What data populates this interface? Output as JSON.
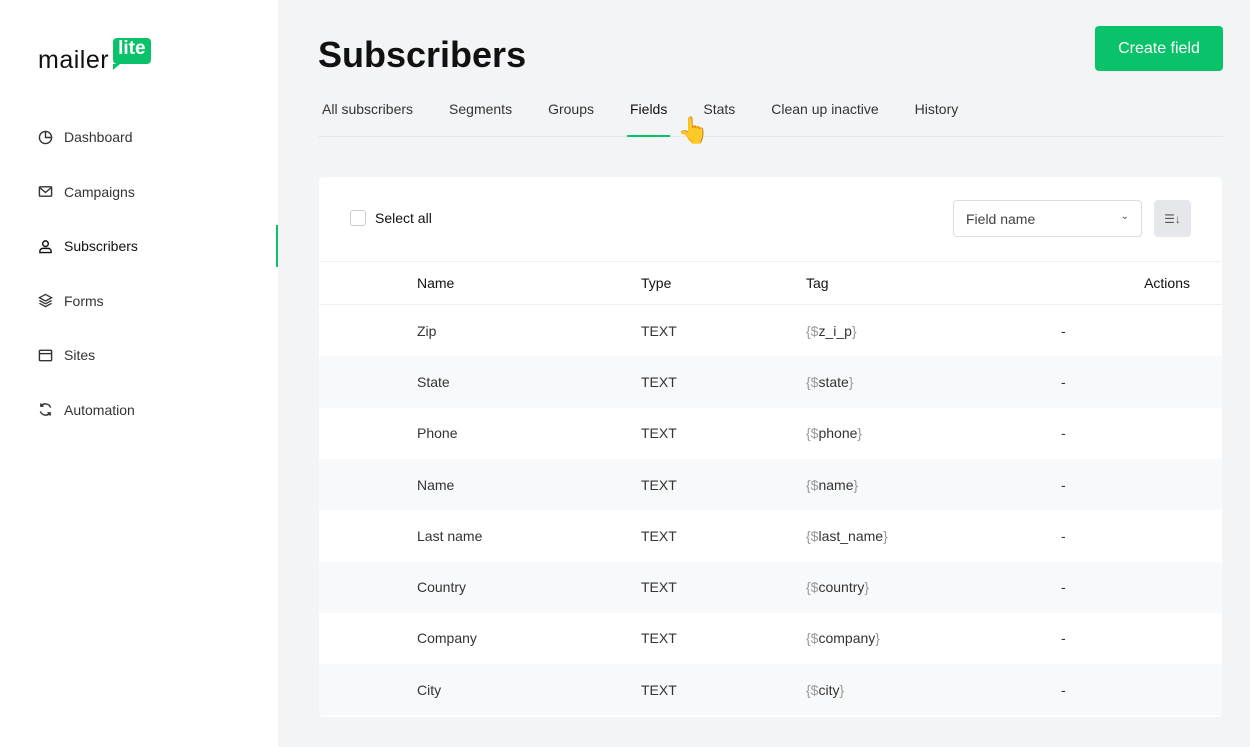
{
  "logo": {
    "text": "mailer",
    "badge": "lite"
  },
  "sidebar": {
    "items": [
      {
        "label": "Dashboard",
        "icon": "clock-pie-icon"
      },
      {
        "label": "Campaigns",
        "icon": "mail-icon"
      },
      {
        "label": "Subscribers",
        "icon": "user-icon",
        "active": true
      },
      {
        "label": "Forms",
        "icon": "layers-icon"
      },
      {
        "label": "Sites",
        "icon": "browser-icon"
      },
      {
        "label": "Automation",
        "icon": "refresh-icon"
      }
    ]
  },
  "header": {
    "title": "Subscribers",
    "create_label": "Create field"
  },
  "tabs": [
    "All subscribers",
    "Segments",
    "Groups",
    "Fields",
    "Stats",
    "Clean up inactive",
    "History"
  ],
  "active_tab": "Fields",
  "toolbar": {
    "select_all": "Select all",
    "sort_select": "Field name"
  },
  "table": {
    "headers": [
      "Name",
      "Type",
      "Tag",
      "Actions"
    ],
    "rows": [
      {
        "name": "Zip",
        "type": "TEXT",
        "tag": "z_i_p",
        "action": "-"
      },
      {
        "name": "State",
        "type": "TEXT",
        "tag": "state",
        "action": "-"
      },
      {
        "name": "Phone",
        "type": "TEXT",
        "tag": "phone",
        "action": "-"
      },
      {
        "name": "Name",
        "type": "TEXT",
        "tag": "name",
        "action": "-"
      },
      {
        "name": "Last name",
        "type": "TEXT",
        "tag": "last_name",
        "action": "-"
      },
      {
        "name": "Country",
        "type": "TEXT",
        "tag": "country",
        "action": "-"
      },
      {
        "name": "Company",
        "type": "TEXT",
        "tag": "company",
        "action": "-"
      },
      {
        "name": "City",
        "type": "TEXT",
        "tag": "city",
        "action": "-"
      }
    ]
  },
  "colors": {
    "accent": "#09c269"
  }
}
